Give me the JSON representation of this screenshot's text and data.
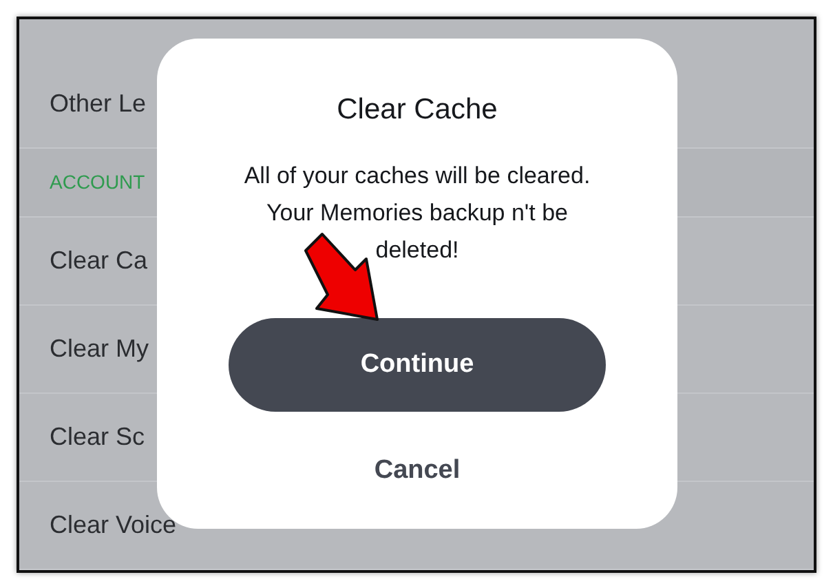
{
  "settings_rows": [
    {
      "kind": "item",
      "label": "Other Le"
    },
    {
      "kind": "header",
      "label": "ACCOUNT"
    },
    {
      "kind": "item",
      "label": "Clear Ca"
    },
    {
      "kind": "item",
      "label": "Clear My"
    },
    {
      "kind": "item",
      "label": "Clear Sc"
    },
    {
      "kind": "item",
      "label": "Clear Voice"
    }
  ],
  "dialog": {
    "title": "Clear Cache",
    "message": "All of your caches will be cleared. Your Memories backup n't be deleted!",
    "buttons": [
      {
        "kind": "primary",
        "label": "Continue"
      },
      {
        "kind": "plain",
        "label": "Cancel"
      }
    ]
  }
}
